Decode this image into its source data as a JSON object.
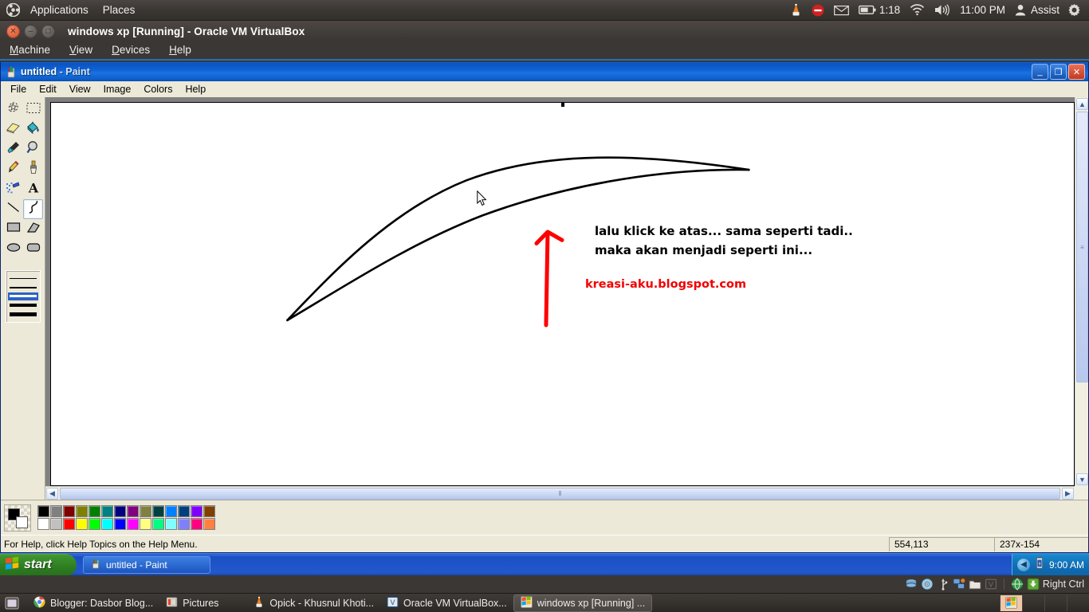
{
  "ubuntu_top": {
    "logo_icon": "ubuntu-logo-icon",
    "menus": [
      {
        "label": "Applications",
        "name": "applications-menu"
      },
      {
        "label": "Places",
        "name": "places-menu"
      }
    ],
    "tray": {
      "vlc_icon": "vlc-cone-icon",
      "dnd_icon": "do-not-disturb-icon",
      "mail_icon": "envelope-icon",
      "battery_icon": "battery-icon",
      "battery_time": "1:18",
      "wifi_icon": "wifi-icon",
      "volume_icon": "volume-icon",
      "clock": "11:00 PM",
      "user_icon": "user-icon",
      "user_name": "Assist",
      "settings_icon": "gear-icon"
    }
  },
  "vbox": {
    "title": "windows xp [Running] - Oracle VM VirtualBox",
    "buttons": {
      "close": "close-icon",
      "minimize": "minimize-icon",
      "maximize": "maximize-icon"
    },
    "menus": [
      {
        "label": "Machine",
        "mnemonic": "M",
        "name": "vbox-menu-machine"
      },
      {
        "label": "View",
        "mnemonic": "V",
        "name": "vbox-menu-view"
      },
      {
        "label": "Devices",
        "mnemonic": "D",
        "name": "vbox-menu-devices"
      },
      {
        "label": "Help",
        "mnemonic": "H",
        "name": "vbox-menu-help"
      }
    ],
    "statusbar": {
      "icons": [
        "hard-disk-icon",
        "optical-disk-icon",
        "usb-icon",
        "network-icon",
        "shared-folder-icon",
        "video-capture-icon",
        "globe-icon",
        "host-key-icon"
      ],
      "host_key": "Right Ctrl"
    }
  },
  "paint": {
    "app_icon": "paint-palette-icon",
    "title_document": "untitled",
    "title_suffix": " - Paint",
    "window_buttons": {
      "minimize": "minimize-icon",
      "restore": "restore-icon",
      "close": "close-icon"
    },
    "menus": [
      {
        "label": "File",
        "name": "paint-menu-file"
      },
      {
        "label": "Edit",
        "name": "paint-menu-edit"
      },
      {
        "label": "View",
        "name": "paint-menu-view"
      },
      {
        "label": "Image",
        "name": "paint-menu-image"
      },
      {
        "label": "Colors",
        "name": "paint-menu-colors"
      },
      {
        "label": "Help",
        "name": "paint-menu-help"
      }
    ],
    "tools": [
      {
        "name": "free-form-select-tool",
        "icon": "free-form-select-icon",
        "selected": false
      },
      {
        "name": "rectangular-select-tool",
        "icon": "rectangle-select-icon",
        "selected": false
      },
      {
        "name": "eraser-tool",
        "icon": "eraser-icon",
        "selected": false
      },
      {
        "name": "fill-tool",
        "icon": "paint-bucket-icon",
        "selected": false
      },
      {
        "name": "color-picker-tool",
        "icon": "eyedropper-icon",
        "selected": false
      },
      {
        "name": "magnifier-tool",
        "icon": "magnifier-icon",
        "selected": false
      },
      {
        "name": "pencil-tool",
        "icon": "pencil-icon",
        "selected": false
      },
      {
        "name": "brush-tool",
        "icon": "brush-icon",
        "selected": false
      },
      {
        "name": "airbrush-tool",
        "icon": "airbrush-icon",
        "selected": false
      },
      {
        "name": "text-tool",
        "icon": "text-a-icon",
        "selected": false
      },
      {
        "name": "line-tool",
        "icon": "line-icon",
        "selected": false
      },
      {
        "name": "curve-tool",
        "icon": "curve-icon",
        "selected": true
      },
      {
        "name": "rectangle-tool",
        "icon": "rectangle-icon",
        "selected": false
      },
      {
        "name": "polygon-tool",
        "icon": "polygon-icon",
        "selected": false
      },
      {
        "name": "ellipse-tool",
        "icon": "ellipse-icon",
        "selected": false
      },
      {
        "name": "rounded-rectangle-tool",
        "icon": "rounded-rectangle-icon",
        "selected": false
      }
    ],
    "line_widths": [
      {
        "thickness": 1,
        "selected": false
      },
      {
        "thickness": 2,
        "selected": false
      },
      {
        "thickness": 3,
        "selected": true
      },
      {
        "thickness": 4,
        "selected": false
      },
      {
        "thickness": 5,
        "selected": false
      }
    ],
    "palette": {
      "foreground_color": "#000000",
      "background_color": "#ffffff",
      "row1": [
        "#000000",
        "#808080",
        "#800000",
        "#808000",
        "#008000",
        "#008080",
        "#000080",
        "#800080",
        "#808040",
        "#004040",
        "#0080ff",
        "#004080",
        "#8000ff",
        "#804000"
      ],
      "row2": [
        "#ffffff",
        "#c0c0c0",
        "#ff0000",
        "#ffff00",
        "#00ff00",
        "#00ffff",
        "#0000ff",
        "#ff00ff",
        "#ffff80",
        "#00ff80",
        "#80ffff",
        "#8080ff",
        "#ff0080",
        "#ff8040"
      ]
    },
    "canvas": {
      "text_line_1": "lalu klick ke atas... sama seperti tadi..",
      "text_line_2": "maka akan menjadi seperti ini...",
      "watermark": "kreasi-aku.blogspot.com",
      "watermark_color": "#f20000",
      "arrow_color": "#ff0000",
      "stroke_color": "#000000",
      "cursor_icon": "arrow-cursor-icon"
    },
    "scrollbars": {
      "vertical": {
        "up_icon": "chevron-up-icon",
        "down_icon": "chevron-down-icon",
        "grip_icon": "grip-icon"
      },
      "horizontal": {
        "left_icon": "chevron-left-icon",
        "right_icon": "chevron-right-icon",
        "grip_icon": "grip-icon"
      }
    },
    "statusbar": {
      "hint": "For Help, click Help Topics on the Help Menu.",
      "cursor_position": "554,113",
      "selection_size": "237x-154"
    }
  },
  "xp_taskbar": {
    "start_label": "start",
    "start_icon": "windows-flag-icon",
    "tasks": [
      {
        "label": "untitled - Paint",
        "icon": "paint-palette-icon",
        "active": true
      }
    ],
    "tray": {
      "chevron_icon": "chevron-left-icon",
      "power_icon": "battery-power-icon",
      "clock": "9:00 AM"
    }
  },
  "ubuntu_bottom": {
    "show_desktop_icon": "show-desktop-icon",
    "windows": [
      {
        "label": "Blogger: Dasbor Blog...",
        "icon": "chrome-icon",
        "active": false,
        "name": "taskbar-item-blogger"
      },
      {
        "label": "Pictures",
        "icon": "folder-icon",
        "active": false,
        "name": "taskbar-item-pictures"
      },
      {
        "label": "Opick - Khusnul Khoti...",
        "icon": "vlc-cone-icon",
        "active": false,
        "name": "taskbar-item-vlc"
      },
      {
        "label": "Oracle VM VirtualBox...",
        "icon": "virtualbox-icon",
        "active": false,
        "name": "taskbar-item-virtualbox-manager"
      },
      {
        "label": "windows xp [Running] ...",
        "icon": "windows-xp-icon",
        "active": true,
        "name": "taskbar-item-windows-xp"
      }
    ],
    "workspaces": [
      {
        "active": true,
        "name": "workspace-1"
      },
      {
        "active": false,
        "name": "workspace-2"
      },
      {
        "active": false,
        "name": "workspace-3"
      },
      {
        "active": false,
        "name": "workspace-4"
      }
    ]
  }
}
